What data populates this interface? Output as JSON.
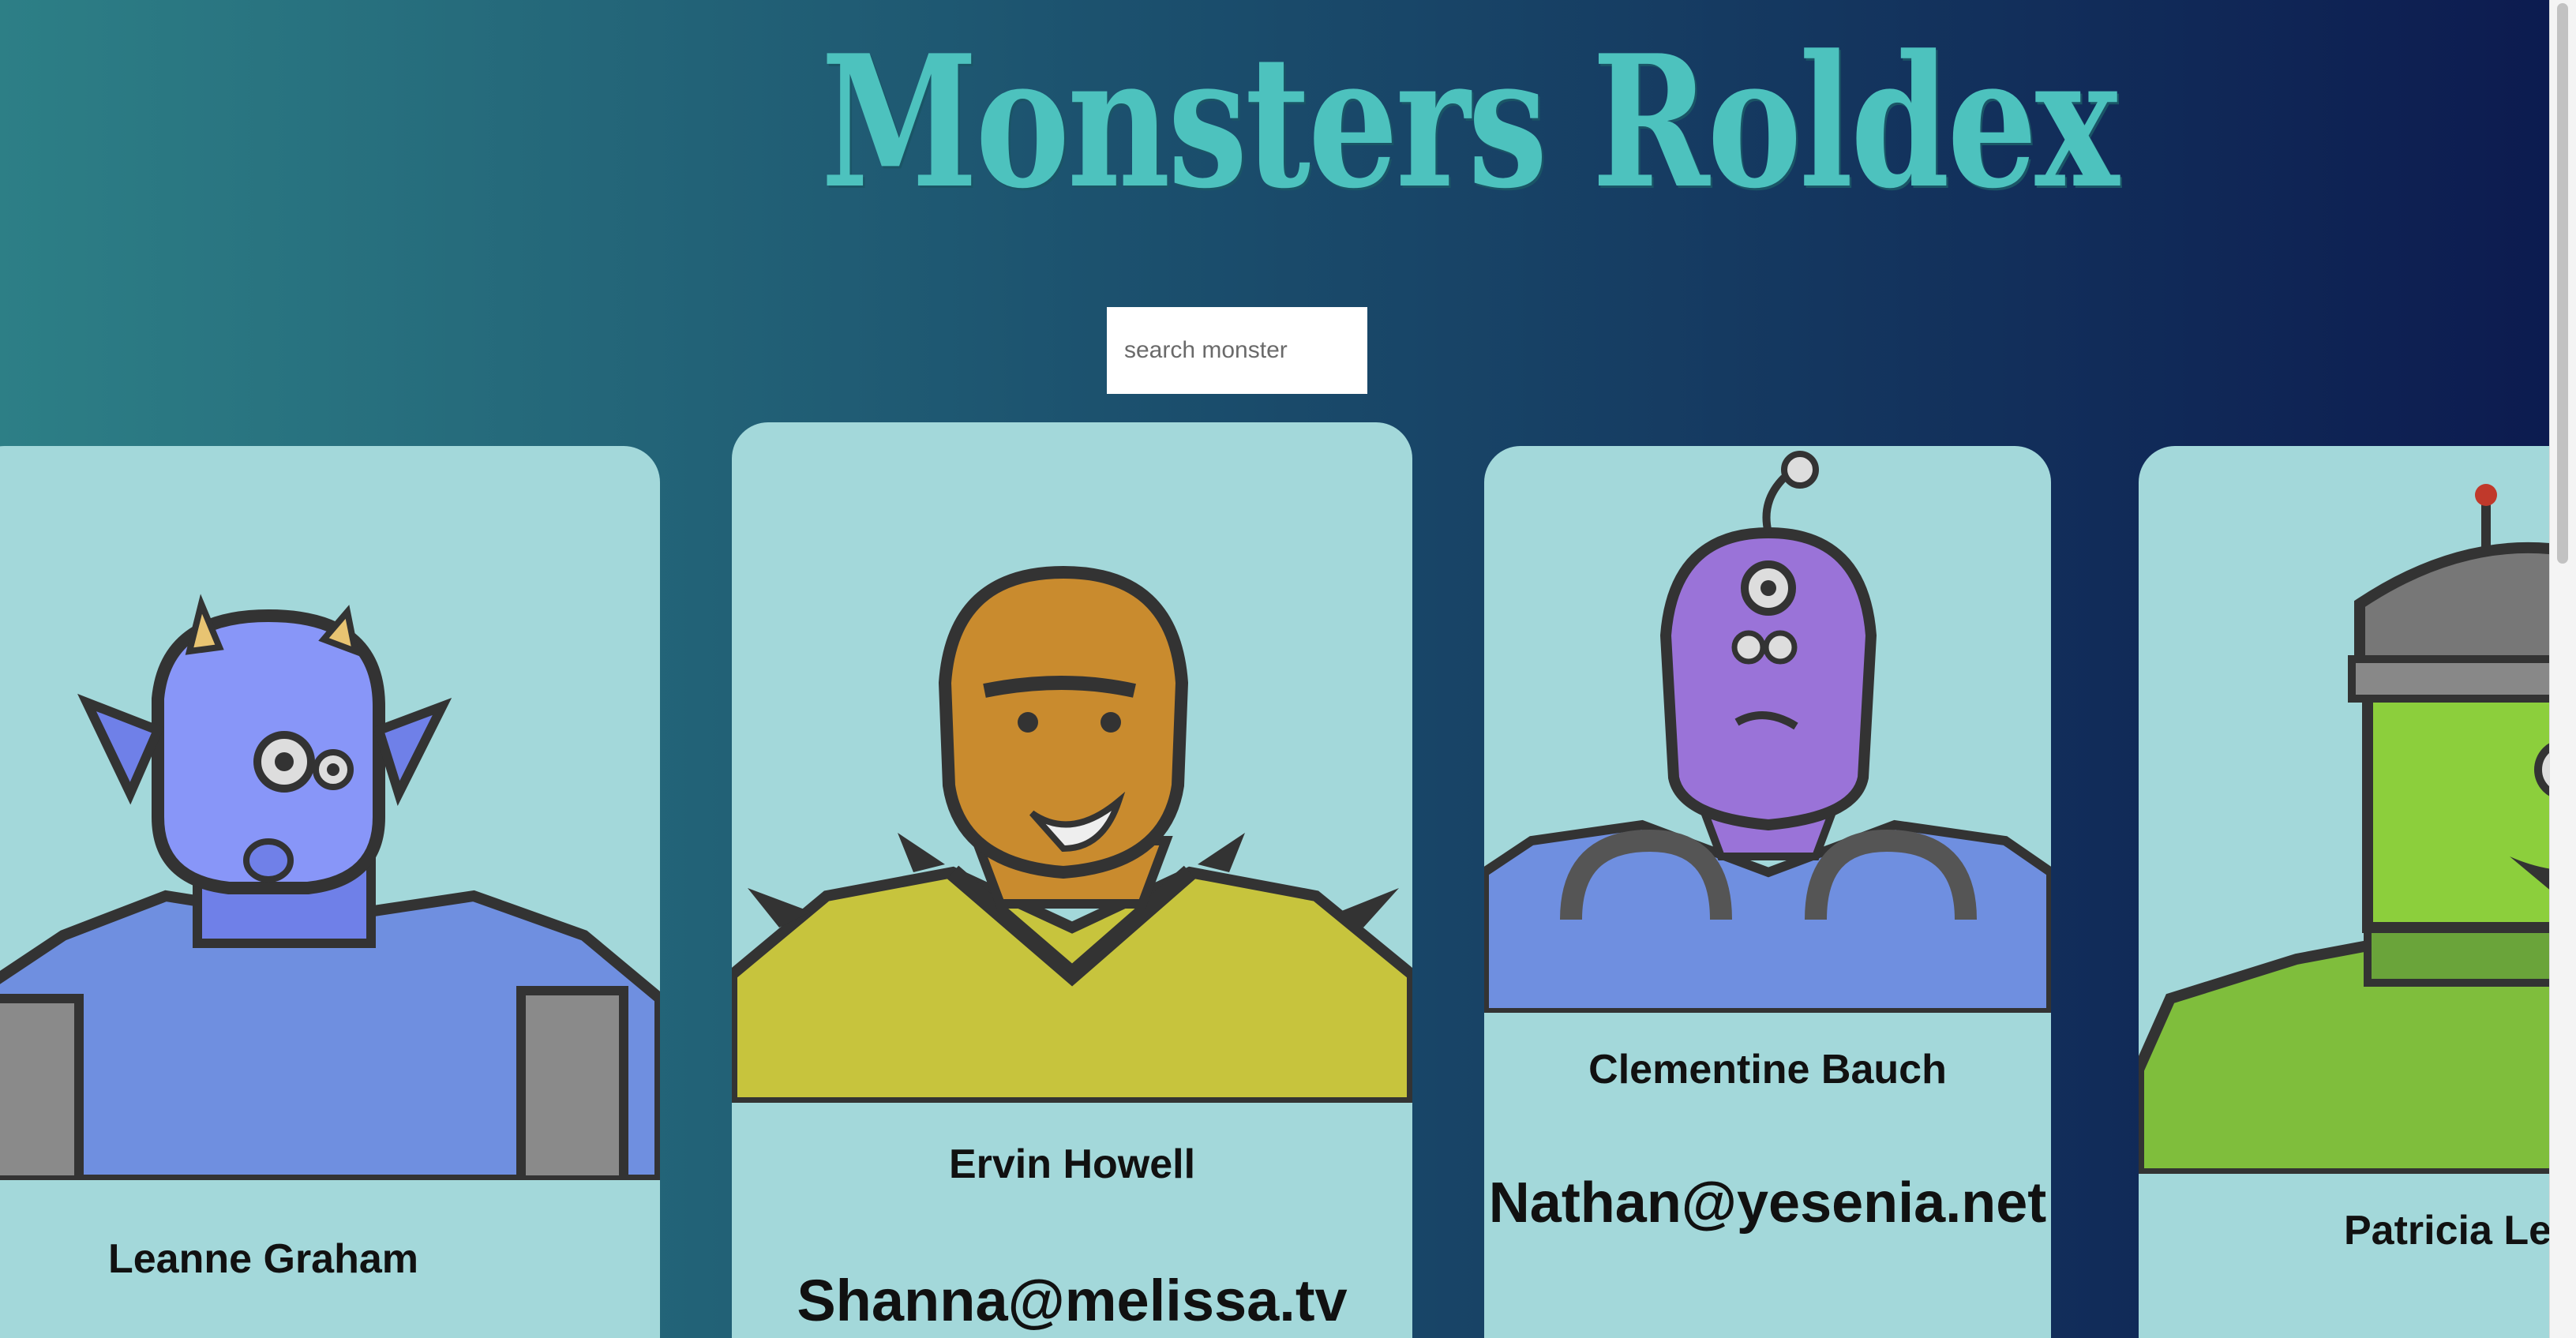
{
  "app": {
    "title": "Monsters Roldex"
  },
  "search": {
    "placeholder": "search monster",
    "value": ""
  },
  "monsters": [
    {
      "name": "Leanne Graham",
      "email": "",
      "color": "#8896f8"
    },
    {
      "name": "Ervin Howell",
      "email": "Shanna@melissa.tv",
      "color": "#c98b2e"
    },
    {
      "name": "Clementine Bauch",
      "email": "Nathan@yesenia.net",
      "color": "#9a73d8"
    },
    {
      "name": "Patricia Lebsack",
      "email": "",
      "color": "#8ccf3c"
    }
  ],
  "colors": {
    "card_bg": "#a3d8da",
    "title": "#4dc2be",
    "gradient_start": "#2d7f86",
    "gradient_end": "#0c1a4f"
  }
}
